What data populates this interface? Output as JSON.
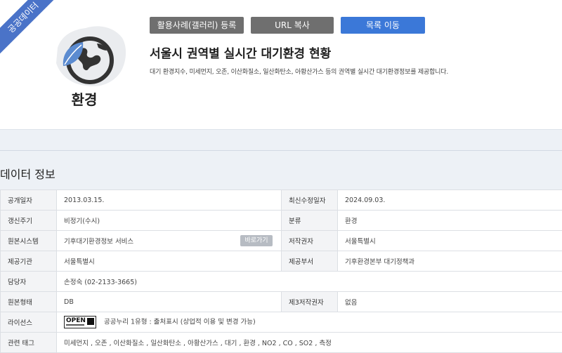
{
  "card": {
    "ribbon": "공공데이터",
    "category": "환경",
    "buttons": {
      "gallery": "활용사례(갤러리) 등록",
      "url": "URL 복사",
      "list": "목록 이동"
    },
    "title": "서울시 권역별 실시간 대기환경 현황",
    "description": "대기 환경지수, 미세먼지, 오존, 이산화질소, 일산화탄소, 아황산가스 등의 권역별 실시간 대기환경정보를 제공합니다."
  },
  "section_title": "데이터 정보",
  "info": {
    "public_date_label": "공개일자",
    "public_date": "2013.03.15.",
    "last_modified_label": "최신수정일자",
    "last_modified": "2024.09.03.",
    "update_cycle_label": "갱신주기",
    "update_cycle": "비정기(수시)",
    "category_label": "분류",
    "category": "환경",
    "source_system_label": "원본시스템",
    "source_system": "기후대기환경정보 서비스",
    "go_button": "바로가기",
    "copyright_label": "저작권자",
    "copyright": "서울특별시",
    "provider_label": "제공기관",
    "provider": "서울특별시",
    "dept_label": "제공부서",
    "dept": "기후환경본부 대기정책과",
    "contact_label": "담당자",
    "contact": "손정숙 (02-2133-3665)",
    "format_label": "원본형태",
    "format": "DB",
    "third_party_label": "제3저작권자",
    "third_party": "없음",
    "license_label": "라이선스",
    "license_badge": "OPEN",
    "license": "공공누리 1유형 : 출처표시 (상업적 이용 및 변경 가능)",
    "tags_label": "관련 태그",
    "tags": "미세먼지 , 오존 , 이산화질소 , 일산화탄소 , 아황산가스 , 대기 , 환경 , NO2 , CO , SO2 , 측정"
  },
  "colors": {
    "ribbon": "#4a73c8",
    "gray_button": "#6f6f6f",
    "blue_button": "#3b78d8",
    "icon_dark": "#333333",
    "icon_leaf": "#5b8bd0"
  }
}
